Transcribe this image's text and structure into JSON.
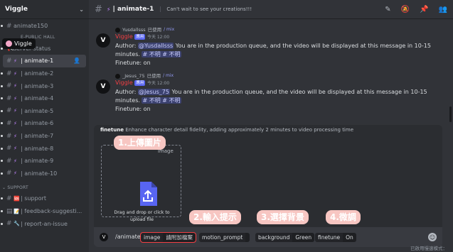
{
  "server": {
    "name": "Viggle",
    "tooltip": "Viggle"
  },
  "channels": [
    {
      "name": "animate150",
      "emoji": "",
      "active": false
    },
    {
      "name": "server-status",
      "emoji": "",
      "active": false
    },
    {
      "name": "| animate-1",
      "emoji": "⚡",
      "active": true
    },
    {
      "name": "| animate-2",
      "emoji": "⚡",
      "active": false
    },
    {
      "name": "| animate-3",
      "emoji": "⚡",
      "active": false
    },
    {
      "name": "| animate-4",
      "emoji": "⚡",
      "active": false
    },
    {
      "name": "| animate-5",
      "emoji": "⚡",
      "active": false
    },
    {
      "name": "| animate-6",
      "emoji": "⚡",
      "active": false
    },
    {
      "name": "| animate-7",
      "emoji": "⚡",
      "active": false
    },
    {
      "name": "| animate-8",
      "emoji": "⚡",
      "active": false
    },
    {
      "name": "| animate-9",
      "emoji": "⚡",
      "active": false
    },
    {
      "name": "| animate-10",
      "emoji": "⚡",
      "active": false
    }
  ],
  "categories": {
    "public_hall": "E-PUBLIC HALL",
    "support": "SUPPORT"
  },
  "support_channels": [
    {
      "name": "| support",
      "emoji": "🆘"
    },
    {
      "name": "| feedback-suggesti...",
      "emoji": "📝"
    },
    {
      "name": "| report-an-issue",
      "emoji": "🔧"
    }
  ],
  "topbar": {
    "emoji": "⚡",
    "title": "| animate-1",
    "topic": "Can't wait to see your creations!!!"
  },
  "messages": [
    {
      "reply_user": "Yusdallsss",
      "reply_text": "已使用",
      "reply_cmd": "/ mix",
      "author": "Viggle",
      "badge": "應用",
      "time": "今天 12:00",
      "author_label": "Author:",
      "mention": "@Yusdallsss",
      "text": "You are in the production queue, and the video will be displayed at this message in 10-15 minutes.",
      "tag": "# 不明 # 不明",
      "finetune": "Finetune: on"
    },
    {
      "reply_user": "_Jesus_75",
      "reply_text": "已使用",
      "reply_cmd": "/ mix",
      "author": "Viggle",
      "badge": "應用",
      "time": "今天 12:00",
      "author_label": "Author:",
      "mention": "@Jesus_75",
      "text": "You are in the production queue, and the video will be displayed at this message in 10-15 minutes.",
      "tag": "# 不明 # 不明",
      "finetune": "Finetune: on"
    }
  ],
  "panel": {
    "hint_key": "finetune",
    "hint_text": "Enhance character detail fidelity, adding approximately 2 minutes to video processing time",
    "drop_label": "image",
    "drop_text_1": "Drag and drop or click to",
    "drop_text_2": "upload file"
  },
  "input": {
    "command": "/animate",
    "options": [
      {
        "key": "image",
        "value": "請附加檔案"
      },
      {
        "key": "motion_prompt",
        "value": ""
      },
      {
        "key": "background",
        "value": "Green"
      },
      {
        "key": "finetune",
        "value": "On"
      }
    ]
  },
  "annotations": [
    "1.上傳圖片",
    "2.輸入提示",
    "3.選擇背景",
    "4.微調"
  ],
  "status": "已啟用慢速模式：",
  "colors": {
    "accent": "#5865f2",
    "annotation": "#f7c6c2",
    "username": "#f23f43"
  }
}
